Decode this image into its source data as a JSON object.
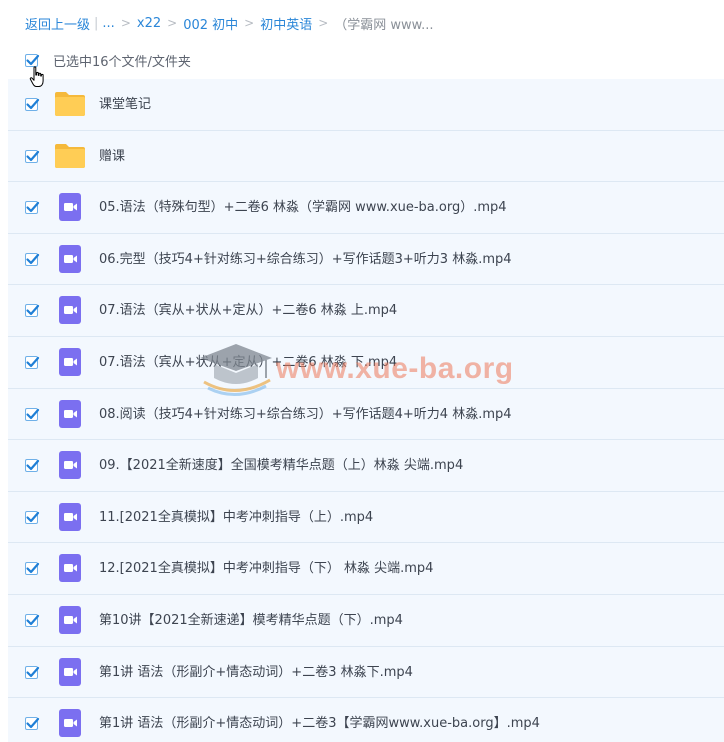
{
  "breadcrumb": {
    "back_label": "返回上一级",
    "ellipsis": "...",
    "items": [
      "x22",
      "002 初中",
      "初中英语"
    ],
    "current": "（学霸网 www...",
    "separator": ">"
  },
  "selection": {
    "text": "已选中16个文件/文件夹",
    "checked": true
  },
  "files": [
    {
      "name": "课堂笔记",
      "type": "folder",
      "checked": true
    },
    {
      "name": "赠课",
      "type": "folder",
      "checked": true
    },
    {
      "name": "05.语法（特殊句型）+二卷6 林淼（学霸网 www.xue-ba.org）.mp4",
      "type": "video",
      "checked": true
    },
    {
      "name": "06.完型（技巧4+针对练习+综合练习）+写作话题3+听力3 林淼.mp4",
      "type": "video",
      "checked": true
    },
    {
      "name": "07.语法（宾从+状从+定从）+二卷6 林淼 上.mp4",
      "type": "video",
      "checked": true
    },
    {
      "name": "07.语法（宾从+状从+定从）+二卷6 林淼 下.mp4",
      "type": "video",
      "checked": true
    },
    {
      "name": "08.阅读（技巧4+针对练习+综合练习）+写作话题4+听力4 林淼.mp4",
      "type": "video",
      "checked": true
    },
    {
      "name": "09.【2021全新速度】全国模考精华点题（上）林淼 尖端.mp4",
      "type": "video",
      "checked": true
    },
    {
      "name": "11.[2021全真模拟】中考冲刺指导（上）.mp4",
      "type": "video",
      "checked": true
    },
    {
      "name": "12.[2021全真模拟】中考冲刺指导（下） 林淼 尖端.mp4",
      "type": "video",
      "checked": true
    },
    {
      "name": "第10讲【2021全新速递】模考精华点题（下）.mp4",
      "type": "video",
      "checked": true
    },
    {
      "name": "第1讲 语法（形副介+情态动词）+二卷3 林淼下.mp4",
      "type": "video",
      "checked": true
    },
    {
      "name": "第1讲 语法（形副介+情态动词）+二卷3【学霸网www.xue-ba.org】.mp4",
      "type": "video",
      "checked": true
    }
  ],
  "watermark": {
    "text": "www.xue-ba.org",
    "icon": "graduation-cap-icon"
  },
  "icons": {
    "folder": "folder-icon",
    "video": "video-file-icon",
    "cursor": "hand-pointer-icon"
  },
  "colors": {
    "link": "#2a86d8",
    "checkbox_check": "#1f7fd6",
    "row_background": "#f3f8fe",
    "folder": "#ffc94c",
    "video_icon": "#7b6ff0",
    "watermark": "#ec785a"
  }
}
